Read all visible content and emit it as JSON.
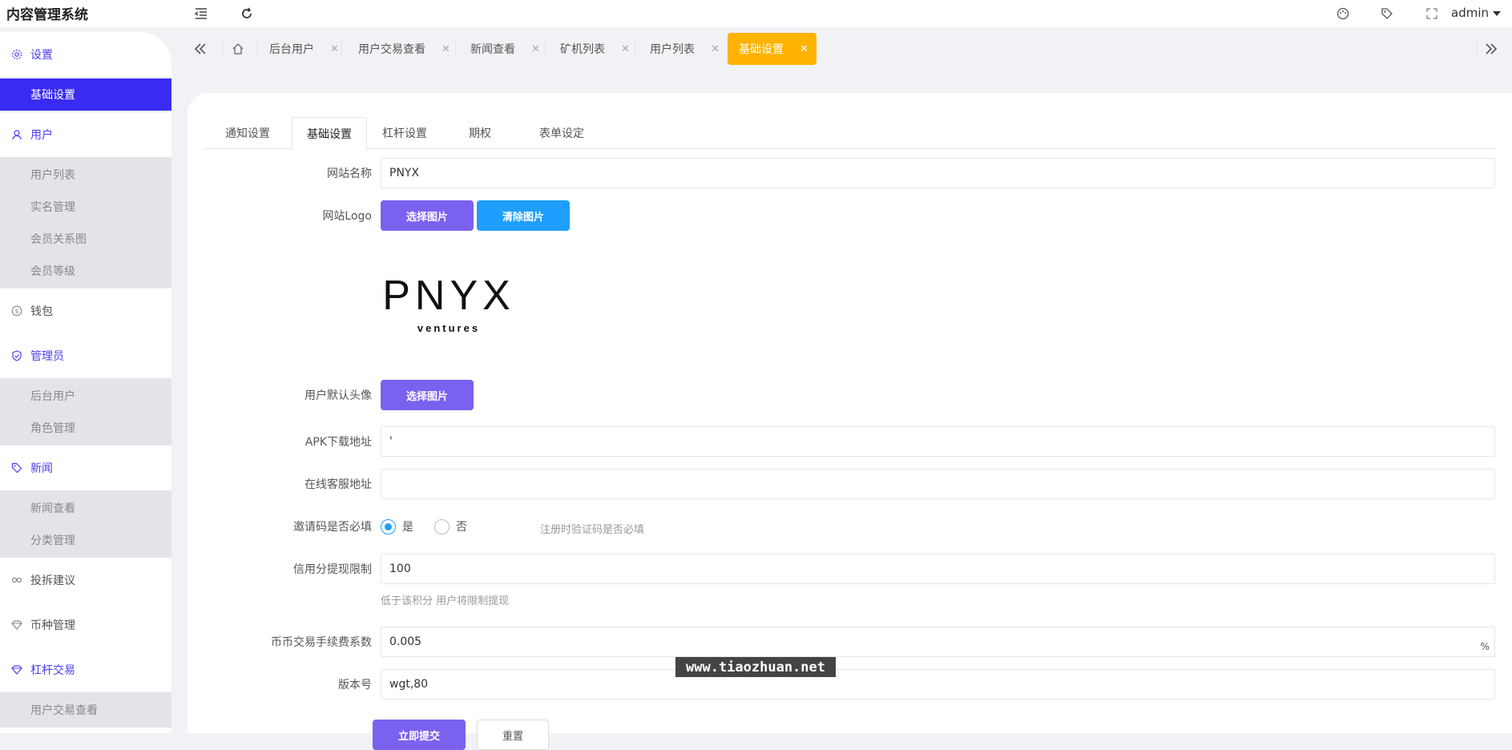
{
  "app": {
    "title": "内容管理系统",
    "user": "admin"
  },
  "sidebar": {
    "sections": [
      {
        "title": "设置",
        "icon": "gear-icon",
        "color": "#4b3ff0",
        "items": [
          {
            "label": "基础设置",
            "active": true
          }
        ]
      },
      {
        "title": "用户",
        "icon": "user-icon",
        "color": "#4b3ff0",
        "items": [
          {
            "label": "用户列表"
          },
          {
            "label": "实名管理"
          },
          {
            "label": "会员关系图"
          },
          {
            "label": "会员等级"
          }
        ]
      },
      {
        "title": "钱包",
        "icon": "dollar-icon",
        "color": "#555555",
        "items": []
      },
      {
        "title": "管理员",
        "icon": "shield-icon",
        "color": "#4b3ff0",
        "items": [
          {
            "label": "后台用户"
          },
          {
            "label": "角色管理"
          }
        ]
      },
      {
        "title": "新闻",
        "icon": "tag-icon",
        "color": "#4b3ff0",
        "items": [
          {
            "label": "新闻查看"
          },
          {
            "label": "分类管理"
          }
        ]
      },
      {
        "title": "投拆建议",
        "icon": "link-icon",
        "color": "#555555",
        "items": []
      },
      {
        "title": "币种管理",
        "icon": "diamond-icon",
        "color": "#555555",
        "items": []
      },
      {
        "title": "杠杆交易",
        "icon": "diamond-icon",
        "color": "#4b3ff0",
        "items": [
          {
            "label": "用户交易查看"
          }
        ]
      }
    ]
  },
  "tabs": [
    {
      "label": "后台用户"
    },
    {
      "label": "用户交易查看"
    },
    {
      "label": "新闻查看"
    },
    {
      "label": "矿机列表"
    },
    {
      "label": "用户列表"
    },
    {
      "label": "基础设置",
      "active": true
    }
  ],
  "inner_tabs": [
    {
      "label": "通知设置"
    },
    {
      "label": "基础设置",
      "active": true
    },
    {
      "label": "杠杆设置"
    },
    {
      "label": "期权"
    },
    {
      "label": "表单设定"
    }
  ],
  "form": {
    "site_name": {
      "label": "网站名称",
      "value": "PNYX"
    },
    "site_logo": {
      "label": "网站Logo",
      "select_btn": "选择图片",
      "clear_btn": "清除图片",
      "logo_text": "PNYX",
      "logo_sub": "ventures"
    },
    "default_avatar": {
      "label": "用户默认头像",
      "select_btn": "选择图片"
    },
    "apk_url": {
      "label": "APK下载地址",
      "value": "'"
    },
    "service_url": {
      "label": "在线客服地址",
      "value": ""
    },
    "invite_required": {
      "label": "邀请码是否必填",
      "yes": "是",
      "no": "否",
      "selected": "yes",
      "hint": "注册时验证码是否必填"
    },
    "credit_limit": {
      "label": "信用分提现限制",
      "value": "100",
      "hint": "低于该积分 用户将限制提现"
    },
    "coin_fee": {
      "label": "币币交易手续费系数",
      "value": "0.005",
      "unit": "%"
    },
    "version": {
      "label": "版本号",
      "value": "wgt,80"
    },
    "submit_btn": "立即提交",
    "reset_btn": "重置"
  },
  "watermark": "www.tiaozhuan.net",
  "colors": {
    "accent": "#3a2bf2",
    "active_tab": "#ffb300",
    "purple_btn": "#7b61f0",
    "blue_btn": "#1e9fff"
  }
}
